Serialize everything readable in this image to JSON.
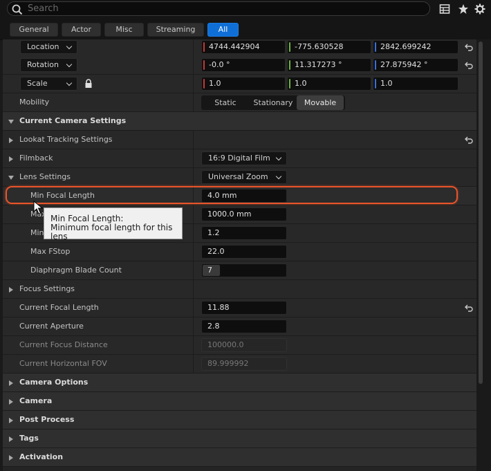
{
  "search": {
    "placeholder": "Search"
  },
  "toolbar_icons": [
    "table-view-icon",
    "star-icon",
    "gear-icon"
  ],
  "filters": [
    {
      "label": "General",
      "active": false
    },
    {
      "label": "Actor",
      "active": false
    },
    {
      "label": "Misc",
      "active": false
    },
    {
      "label": "Streaming",
      "active": false
    },
    {
      "label": "All",
      "active": true
    }
  ],
  "transform": {
    "location": {
      "label": "Location",
      "x": "4744.442904",
      "y": "-775.630528",
      "z": "2842.699242"
    },
    "rotation": {
      "label": "Rotation",
      "x": "-0.0 °",
      "y": "11.317273 °",
      "z": "27.875942 °"
    },
    "scale": {
      "label": "Scale",
      "x": "1.0",
      "y": "1.0",
      "z": "1.0"
    },
    "mobility": {
      "label": "Mobility",
      "options": [
        "Static",
        "Stationary",
        "Movable"
      ],
      "selected": "Movable"
    }
  },
  "camera_settings": {
    "title": "Current Camera Settings",
    "lookat": "Lookat Tracking Settings",
    "filmback": {
      "label": "Filmback",
      "value": "16:9 Digital Film"
    },
    "lens": {
      "label": "Lens Settings",
      "value": "Universal Zoom",
      "min_focal_length": {
        "label": "Min Focal Length",
        "value": "4.0 mm"
      },
      "max_focal_length": {
        "label": "Max Focal Length",
        "value": "1000.0 mm"
      },
      "min_fstop": {
        "label": "Min FStop",
        "value": "1.2"
      },
      "max_fstop": {
        "label": "Max FStop",
        "value": "22.0"
      },
      "diaphragm": {
        "label": "Diaphragm Blade Count",
        "value": "7"
      }
    },
    "focus": "Focus Settings",
    "current_focal_length": {
      "label": "Current Focal Length",
      "value": "11.88"
    },
    "current_aperture": {
      "label": "Current Aperture",
      "value": "2.8"
    },
    "current_focus_distance": {
      "label": "Current Focus Distance",
      "value": "100000.0"
    },
    "current_hfov": {
      "label": "Current Horizontal FOV",
      "value": "89.999992"
    }
  },
  "categories": [
    "Camera Options",
    "Camera",
    "Post Process",
    "Tags",
    "Activation"
  ],
  "tooltip": {
    "title": "Min Focal Length:",
    "body": "Minimum focal length for this lens"
  },
  "colors": {
    "accent": "#0f6fd6",
    "highlight": "#e8542a",
    "axis_x": "#c43a3a",
    "axis_y": "#6bb33a",
    "axis_z": "#3a6fd6"
  }
}
